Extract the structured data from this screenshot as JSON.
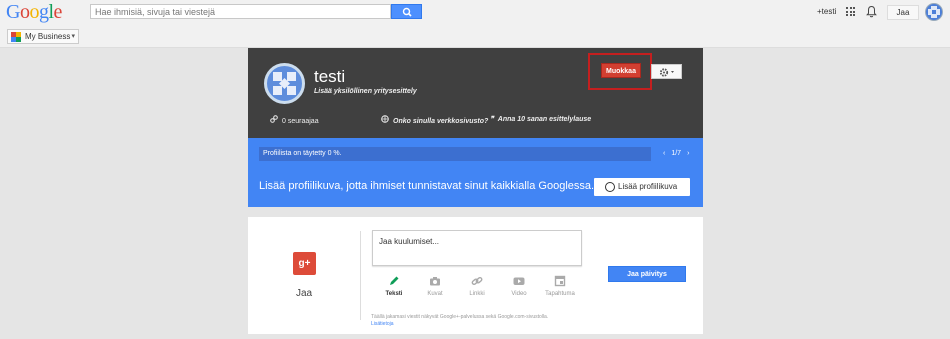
{
  "logo": {
    "text": "Google",
    "letters": [
      "G",
      "o",
      "o",
      "g",
      "l",
      "e"
    ],
    "colors": [
      "#4285f4",
      "#db4437",
      "#f4b400",
      "#4285f4",
      "#0f9d58",
      "#db4437"
    ]
  },
  "search": {
    "placeholder": "Hae ihmisiä, sivuja tai viestejä",
    "icon": "search-icon"
  },
  "topbar": {
    "plus_user": "+testi",
    "share_label": "Jaa"
  },
  "subbar": {
    "product_label": "My Business"
  },
  "profile": {
    "name": "testi",
    "tagline": "Lisää yksilöllinen yritysesittely",
    "edit_label": "Muokkaa",
    "followers": "0 seuraajaa",
    "website_prompt": "Onko sinulla verkkosivusto?",
    "intro_prompt": "Anna 10 sanan esittelylause"
  },
  "completion": {
    "progress_text": "Profiilista on täytetty 0 %.",
    "progress_value": 0,
    "pager": "1/7",
    "message": "Lisää profiilikuva, jotta ihmiset tunnistavat sinut kaikkialla Googlessa.",
    "add_photo_label": "Lisää profiilikuva"
  },
  "share": {
    "badge": "g+",
    "label": "Jaa",
    "compose_placeholder": "Jaa kuulumiset...",
    "tools": [
      {
        "label": "Teksti",
        "icon": "pencil-icon",
        "active": true
      },
      {
        "label": "Kuvat",
        "icon": "camera-icon",
        "active": false
      },
      {
        "label": "Linkki",
        "icon": "link-icon",
        "active": false
      },
      {
        "label": "Video",
        "icon": "video-icon",
        "active": false
      },
      {
        "label": "Tapahtuma",
        "icon": "calendar-icon",
        "active": false
      }
    ],
    "note": "Täällä jakamasi viestit näkyvät Google+-palvelussa sekä Google.com-sivustolla.",
    "note_link": "Lisätietoja",
    "share_button": "Jaa päivitys"
  },
  "colors": {
    "accent_blue": "#4285f4",
    "edit_red": "#d23f31",
    "header_dark": "#404040"
  }
}
